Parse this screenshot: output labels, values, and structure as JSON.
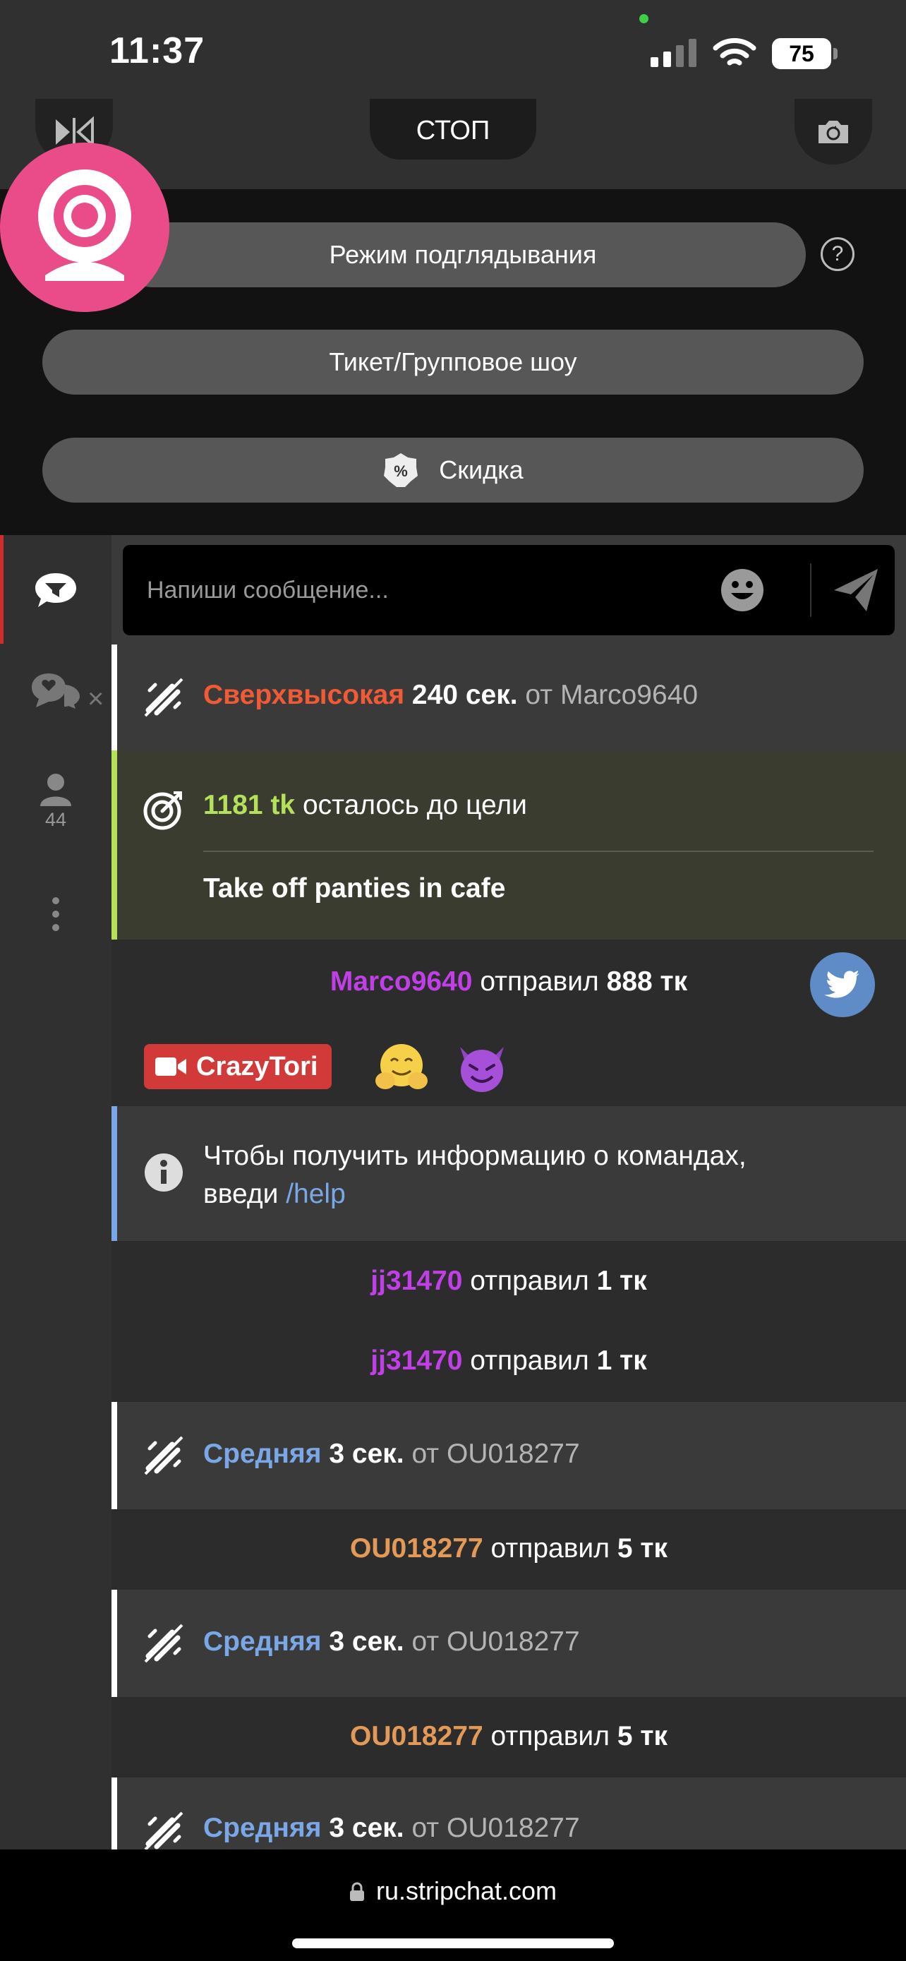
{
  "status_bar": {
    "time": "11:37",
    "battery": "75"
  },
  "top_controls": {
    "stop_label": "СТОП"
  },
  "modes": {
    "peek_label": "Режим подглядывания",
    "ticket_label": "Тикет/Групповое шоу",
    "discount_label": "Скидка"
  },
  "sidebar": {
    "users_count": "44"
  },
  "composer": {
    "placeholder": "Напиши сообщение..."
  },
  "messages": {
    "m1": {
      "level": "Сверхвысокая",
      "duration": "240 сек.",
      "from_word": "от",
      "user": "Marco9640"
    },
    "goal": {
      "amount": "1181 tk",
      "text": "осталось до цели",
      "title": "Take off panties in cafe"
    },
    "tip1": {
      "user": "Marco9640",
      "verb": "отправил",
      "amount": "888 тк"
    },
    "model": {
      "name": "CrazyTori"
    },
    "info": {
      "text_line1": "Чтобы получить информацию о командах,",
      "text_line2": "введи",
      "command": "/help"
    },
    "tip2": {
      "user": "jj31470",
      "verb": "отправил",
      "amount": "1 тк"
    },
    "tip3": {
      "user": "jj31470",
      "verb": "отправил",
      "amount": "1 тк"
    },
    "vib1": {
      "level": "Средняя",
      "duration": "3 сек.",
      "from_word": "от",
      "user": "OU018277"
    },
    "tip4": {
      "user": "OU018277",
      "verb": "отправил",
      "amount": "5 тк"
    },
    "vib2": {
      "level": "Средняя",
      "duration": "3 сек.",
      "from_word": "от",
      "user": "OU018277"
    },
    "tip5": {
      "user": "OU018277",
      "verb": "отправил",
      "amount": "5 тк"
    },
    "vib3": {
      "level": "Средняя",
      "duration": "3 сек.",
      "from_word": "от",
      "user": "OU018277"
    }
  },
  "url_bar": {
    "domain": "ru.stripchat.com"
  },
  "colors": {
    "accent_red": "#f05a34",
    "username_purple": "#c13fe7",
    "username_orange": "#e39a58",
    "level_blue": "#7aa7e6",
    "goal_green": "#b4e05a",
    "logo_pink": "#ea4c89"
  }
}
